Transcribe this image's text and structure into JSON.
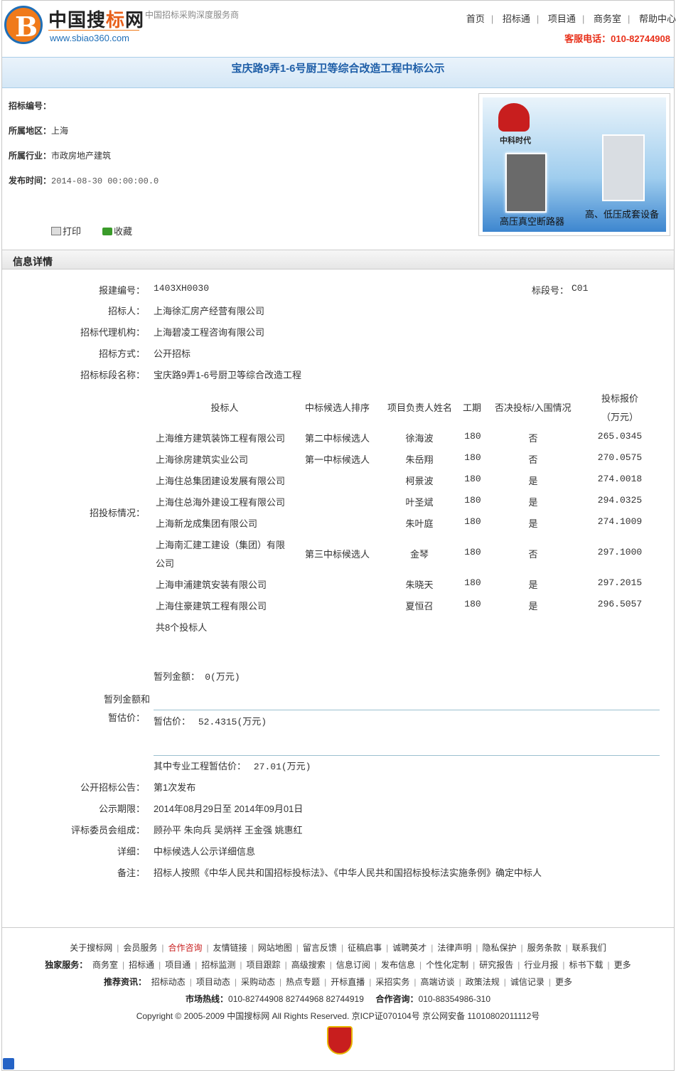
{
  "header": {
    "logo_letter": "B",
    "logo_name_1": "中国搜",
    "logo_name_2": "标",
    "logo_name_3": "网",
    "logo_url": "www.sbiao360.com",
    "slogan": "中国招标采购深度服务商",
    "nav": [
      "首页",
      "招标通",
      "项目通",
      "商务室",
      "帮助中心"
    ],
    "hotline": "客服电话：010-82744908"
  },
  "title": "宝庆路9弄1-6号厨卫等综合改造工程中标公示",
  "meta": {
    "bid_no_label": "招标编号：",
    "bid_no": "",
    "region_label": "所属地区：",
    "region": "上海",
    "industry_label": "所属行业：",
    "industry": "市政房地产建筑",
    "date_label": "发布时间：",
    "date": "2014-08-30 00:00:00.0"
  },
  "tools": {
    "print": "打印",
    "favorite": "收藏"
  },
  "ad": {
    "brand": "中科时代",
    "caption1": "高压真空断路器",
    "caption2": "高、低压成套设备"
  },
  "section_title": "信息详情",
  "detail": {
    "baojian_label": "报建编号：",
    "baojian": "1403XH0030",
    "biaoduan_label": "标段号：",
    "biaoduan": "C01",
    "zhaobiaoren_label": "招标人：",
    "zhaobiaoren": "上海徐汇房产经营有限公司",
    "agent_label": "招标代理机构：",
    "agent": "上海碧凌工程咨询有限公司",
    "method_label": "招标方式：",
    "method": "公开招标",
    "name_label": "招标标段名称：",
    "name": "宝庆路9弄1-6号厨卫等综合改造工程",
    "situation_label": "招投标情况：",
    "bid_headers": {
      "bidder": "投标人",
      "rank": "中标候选人排序",
      "manager": "项目负责人姓名",
      "period": "工期",
      "reject": "否决投标/入围情况",
      "price_1": "投标报价",
      "price_2": "（万元）"
    },
    "bids": [
      {
        "bidder": "上海维方建筑装饰工程有限公司",
        "rank": "第二中标候选人",
        "manager": "徐海波",
        "period": "180",
        "reject": "否",
        "price": "265.0345"
      },
      {
        "bidder": "上海徐房建筑实业公司",
        "rank": "第一中标候选人",
        "manager": "朱岳翔",
        "period": "180",
        "reject": "否",
        "price": "270.0575"
      },
      {
        "bidder": "上海住总集团建设发展有限公司",
        "rank": "",
        "manager": "柯景波",
        "period": "180",
        "reject": "是",
        "price": "274.0018"
      },
      {
        "bidder": "上海住总海外建设工程有限公司",
        "rank": "",
        "manager": "叶圣斌",
        "period": "180",
        "reject": "是",
        "price": "294.0325"
      },
      {
        "bidder": "上海新龙成集团有限公司",
        "rank": "",
        "manager": "朱叶庭",
        "period": "180",
        "reject": "是",
        "price": "274.1009"
      },
      {
        "bidder": "上海南汇建工建设（集团）有限",
        "bidder_2": "公司",
        "rank": "第三中标候选人",
        "manager": "金琴",
        "period": "180",
        "reject": "否",
        "price": "297.1000"
      },
      {
        "bidder": "上海申浦建筑安装有限公司",
        "rank": "",
        "manager": "朱晓天",
        "period": "180",
        "reject": "是",
        "price": "297.2015"
      },
      {
        "bidder": "上海住豪建筑工程有限公司",
        "rank": "",
        "manager": "夏恒召",
        "period": "180",
        "reject": "是",
        "price": "296.5057"
      }
    ],
    "bid_count": "共8个投标人",
    "provisional_label_1": "暂列金额和",
    "provisional_label_2": "暂估价：",
    "provisional_amount_label": "暂列金额：",
    "provisional_amount": "0(万元)",
    "estimate_label": "暂估价：",
    "estimate": "52.4315(万元)",
    "special_label": "其中专业工程暂估价：",
    "special": "27.01(万元)",
    "notice_label": "公开招标公告：",
    "notice": "第1次发布",
    "period_label": "公示期限：",
    "period": "2014年08月29日至 2014年09月01日",
    "committee_label": "评标委员会组成：",
    "committee": "顾孙平 朱向兵 吴炳祥 王金强 姚惠红",
    "detail_label": "详细：",
    "detail_val": "中标候选人公示详细信息",
    "remark_label": "备注：",
    "remark": "招标人按照《中华人民共和国招标投标法》、《中华人民共和国招标投标法实施条例》确定中标人"
  },
  "footer": {
    "links1": [
      "关于搜标网",
      "会员服务",
      "合作咨询",
      "友情链接",
      "网站地图",
      "留言反馈",
      "征稿启事",
      "诚聘英才",
      "法律声明",
      "隐私保护",
      "服务条款",
      "联系我们"
    ],
    "dujia_label": "独家服务：",
    "links2": [
      "商务室",
      "招标通",
      "项目通",
      "招标监测",
      "项目跟踪",
      "高级搜索",
      "信息订阅",
      "发布信息",
      "个性化定制",
      "研究报告",
      "行业月报",
      "标书下载",
      "更多"
    ],
    "tuijian_label": "推荐资讯：",
    "links3": [
      "招标动态",
      "项目动态",
      "采购动态",
      "热点专题",
      "开标直播",
      "采招实务",
      "高端访谈",
      "政策法规",
      "诚信记录",
      "更多"
    ],
    "market_label": "市场热线：",
    "market": "010-82744908 82744968 82744919",
    "coop_label": "合作咨询：",
    "coop": "010-88354986-310",
    "copyright": "Copyright © 2005-2009 中国搜标网 All Rights Reserved. 京ICP证070104号 京公网安备 11010802011112号"
  }
}
